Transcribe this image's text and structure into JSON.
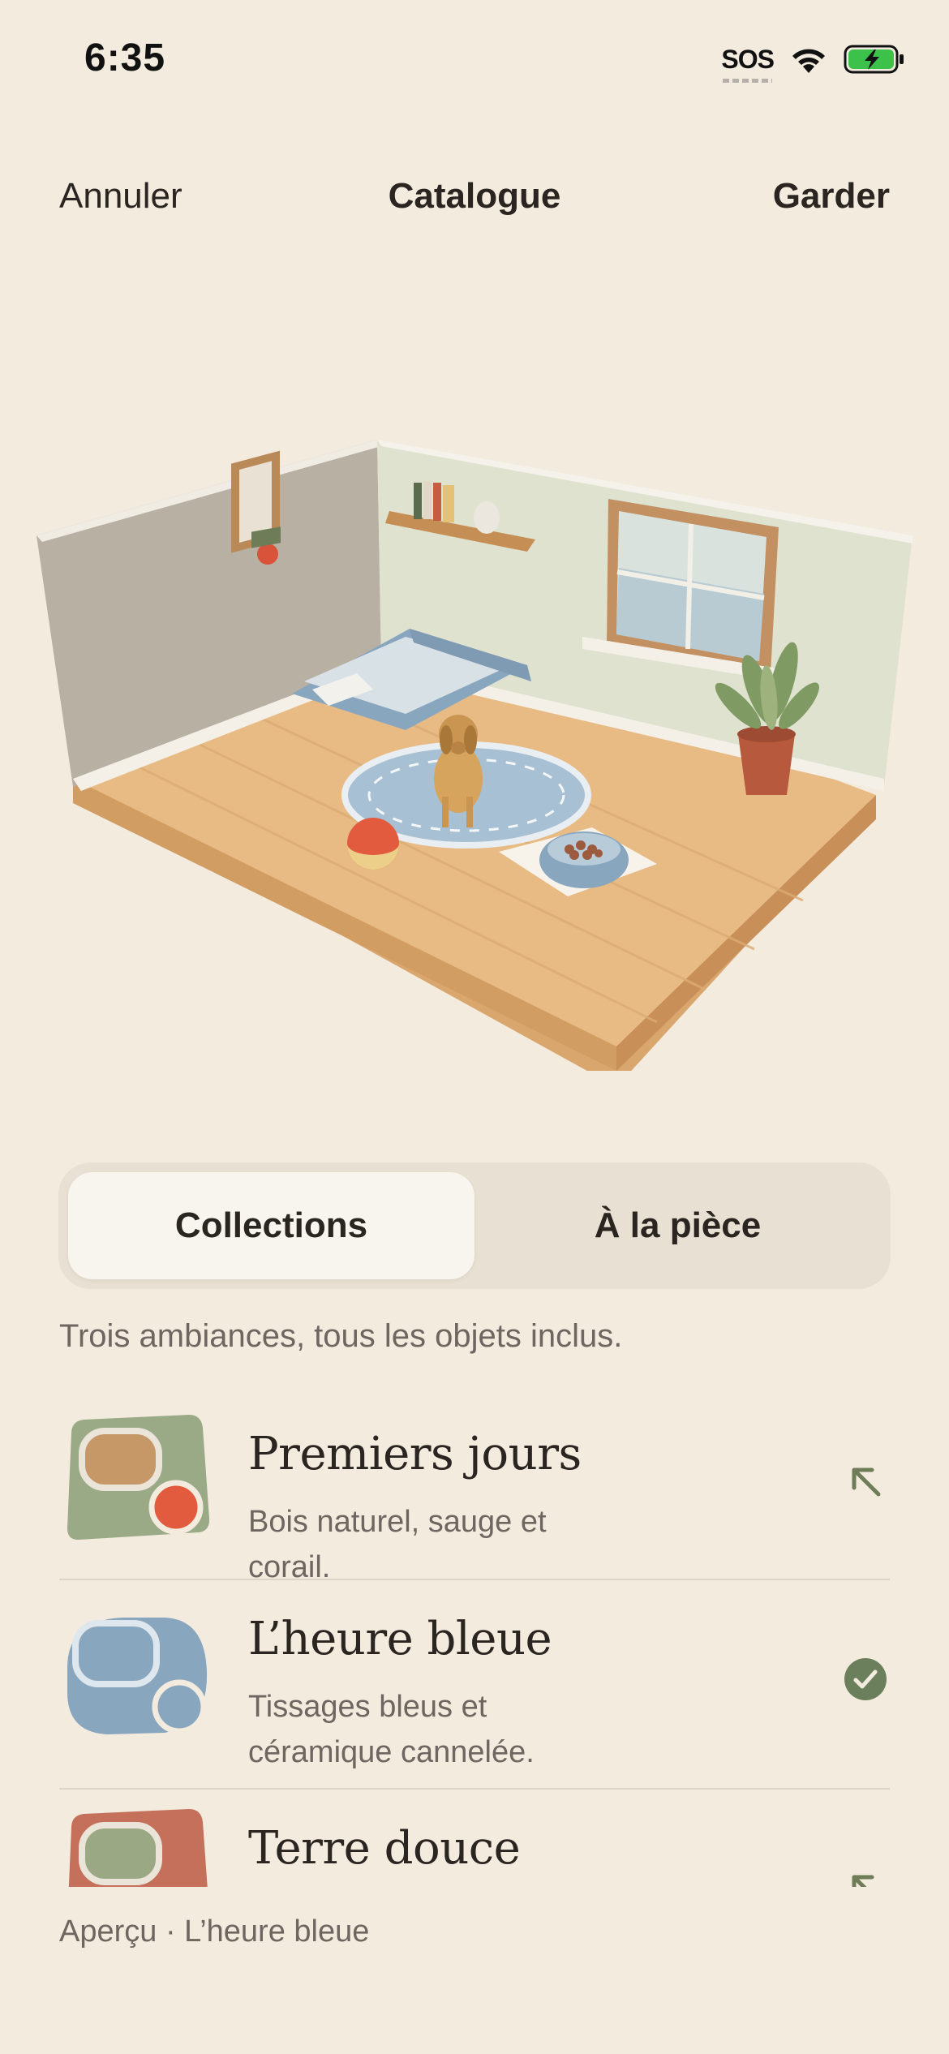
{
  "status_bar": {
    "time": "6:35",
    "sos_label": "SOS",
    "icons": [
      "wifi-icon",
      "battery-charging-icon"
    ]
  },
  "nav": {
    "cancel_label": "Annuler",
    "title": "Catalogue",
    "keep_label": "Garder"
  },
  "segmented": {
    "options": [
      "Collections",
      "À la pièce"
    ],
    "selected": "Collections"
  },
  "subtitle": "Trois ambiances, tous les objets inclus.",
  "collections": [
    {
      "title": "Premiers jours",
      "description": "Bois naturel, sauge et corail.",
      "trailing_icon": "arrow-up-left-icon",
      "colors": {
        "bg": "#9aaa86",
        "inner": "#c69767",
        "dot": "#e25b3f"
      }
    },
    {
      "title": "L’heure bleue",
      "description": "Tissages bleus et céramique cannelée.",
      "trailing_icon": "checkmark-circle-icon",
      "selected": true,
      "colors": {
        "bg": "#89a6bf",
        "inner": "#89a6bf",
        "dot": "#89a6bf"
      }
    },
    {
      "title": "Terre douce",
      "description": "",
      "trailing_icon": "arrow-up-left-icon",
      "colors": {
        "bg": "#c4705a",
        "inner": "#9aa984"
      }
    }
  ],
  "preview_label": "Aperçu · L’heure bleue",
  "colors": {
    "background": "#f4ebdf",
    "accent_check": "#6b7f5c",
    "text_primary": "#2a2520",
    "text_secondary": "#6e6660"
  }
}
